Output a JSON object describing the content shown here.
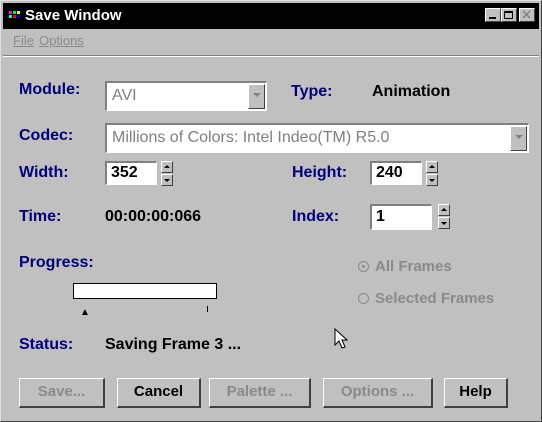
{
  "window": {
    "title": "Save Window"
  },
  "menu": {
    "items": [
      {
        "label": "File"
      },
      {
        "label": "Options"
      }
    ]
  },
  "module": {
    "label": "Module:",
    "value": "AVI"
  },
  "type": {
    "label": "Type:",
    "value": "Animation"
  },
  "codec": {
    "label": "Codec:",
    "value": "Millions of Colors: Intel Indeo(TM) R5.0"
  },
  "width": {
    "label": "Width:",
    "value": "352"
  },
  "height": {
    "label": "Height:",
    "value": "240"
  },
  "time": {
    "label": "Time:",
    "value": "00:00:00:066"
  },
  "index": {
    "label": "Index:",
    "value": "1"
  },
  "progress": {
    "label": "Progress:",
    "fraction": 0.0
  },
  "radios": {
    "all_frames": "All Frames",
    "selected_frames": "Selected Frames",
    "selected": "all_frames"
  },
  "status": {
    "label": "Status:",
    "value": "Saving Frame 3 ..."
  },
  "buttons": {
    "save": "Save...",
    "cancel": "Cancel",
    "palette": "Palette ...",
    "options": "Options ...",
    "help": "Help"
  },
  "colors": {
    "label": "#00007b",
    "disabled": "#8a8a8a",
    "face": "#c0c0c0",
    "titlebar": "#000000"
  }
}
